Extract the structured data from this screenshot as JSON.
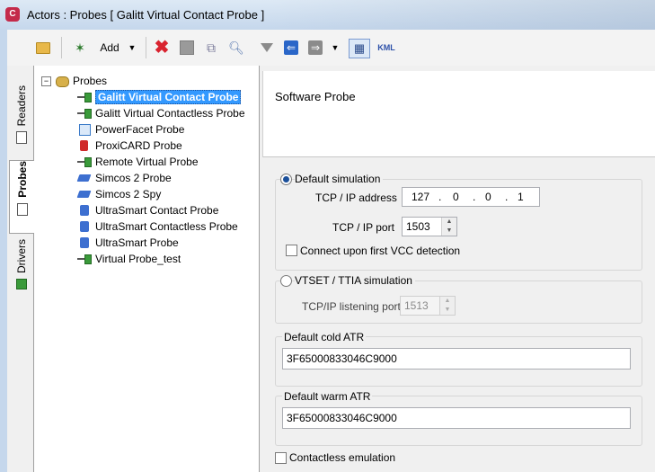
{
  "window": {
    "title": "Actors : Probes [ Galitt Virtual Contact Probe ]"
  },
  "toolbar": {
    "add_label": "Add",
    "kml_label": "KML"
  },
  "tabs": [
    {
      "label": "Readers"
    },
    {
      "label": "Probes"
    },
    {
      "label": "Drivers"
    }
  ],
  "tree": {
    "root": "Probes",
    "items": [
      {
        "label": "Galitt Virtual Contact Probe",
        "selected": true,
        "icon": "contact-probe-icon"
      },
      {
        "label": "Galitt Virtual Contactless Probe",
        "icon": "contactless-probe-icon"
      },
      {
        "label": "PowerFacet Probe",
        "icon": "powerfacet-icon"
      },
      {
        "label": "ProxiCARD Probe",
        "icon": "proxicard-icon"
      },
      {
        "label": "Remote Virtual Probe",
        "icon": "remote-probe-icon"
      },
      {
        "label": "Simcos 2 Probe",
        "icon": "simcos-icon"
      },
      {
        "label": "Simcos 2 Spy",
        "icon": "simcos-spy-icon"
      },
      {
        "label": "UltraSmart Contact Probe",
        "icon": "ultrasmart-icon"
      },
      {
        "label": "UltraSmart Contactless Probe",
        "icon": "ultrasmart-icon"
      },
      {
        "label": "UltraSmart Probe",
        "icon": "ultrasmart-icon"
      },
      {
        "label": "Virtual Probe_test",
        "icon": "contact-probe-icon"
      }
    ]
  },
  "details": {
    "header": "Software Probe",
    "default_sim": {
      "label": "Default simulation",
      "ip_label": "TCP / IP address",
      "ip": [
        "127",
        "0",
        "0",
        "1"
      ],
      "port_label": "TCP / IP port",
      "port": "1503",
      "vcc_label": "Connect upon first VCC detection"
    },
    "vtset": {
      "label": "VTSET / TTIA simulation",
      "port_label": "TCP/IP listening port",
      "port": "1513"
    },
    "cold_atr": {
      "label": "Default cold ATR",
      "value": "3F65000833046C9000"
    },
    "warm_atr": {
      "label": "Default warm ATR",
      "value": "3F65000833046C9000"
    },
    "contactless_label": "Contactless emulation"
  },
  "colors": {
    "selection": "#3399ff",
    "accent": "#1a4f9a"
  }
}
